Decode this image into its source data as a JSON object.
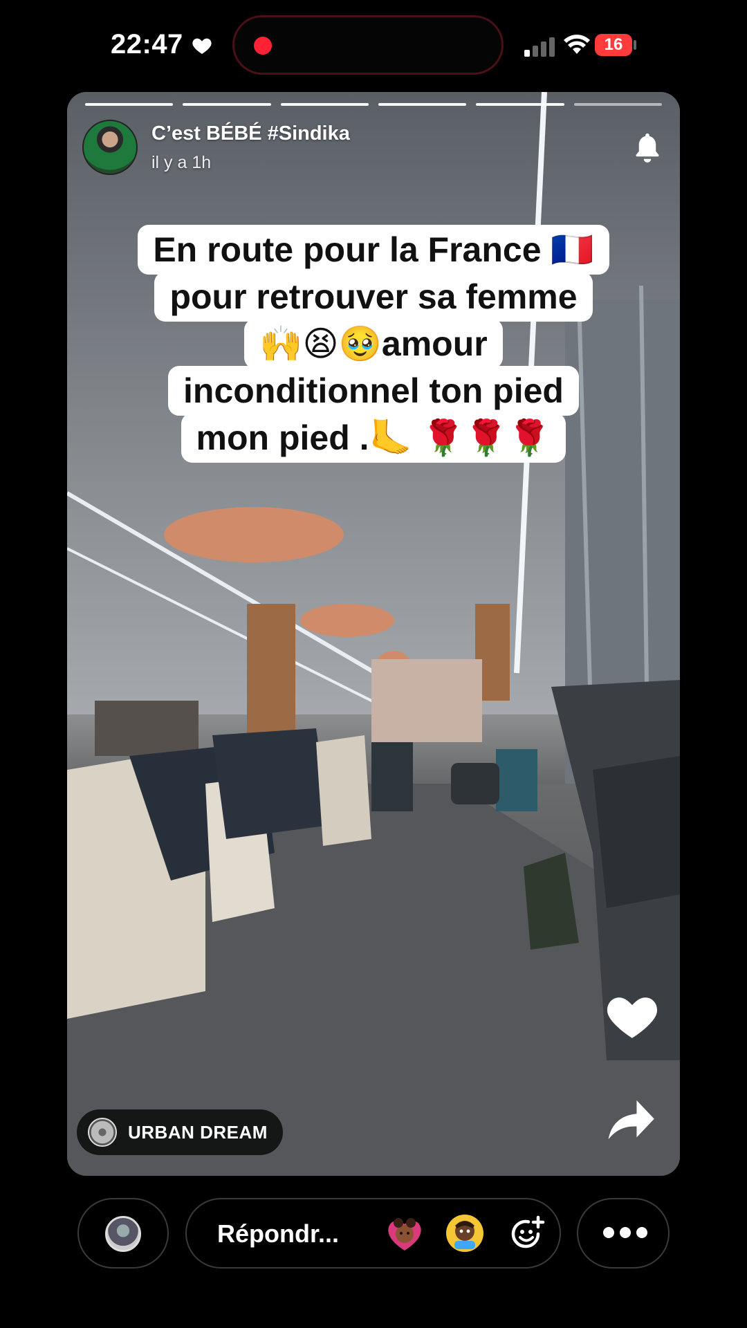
{
  "status_bar": {
    "time": "22:47",
    "battery_level": "16",
    "icons": [
      "heart-icon",
      "recording-dot-icon",
      "cellular-signal-icon",
      "wifi-icon",
      "battery-icon"
    ],
    "recording_color": "#ff2236",
    "battery_color": "#ff3b3b"
  },
  "story": {
    "progress_segments": 6,
    "progress_done": 5,
    "username": "C’est BÉBÉ #Sindika",
    "timestamp": "il y a 1h",
    "caption_lines": [
      "En route pour la France 🇫🇷",
      "pour retrouver sa femme",
      "🙌😫🥹amour",
      "inconditionnel ton pied",
      "mon pied .🦶 🌹🌹🌹"
    ],
    "music_label": "URBAN DREAM",
    "icons": [
      "bell-icon",
      "heart-icon",
      "share-icon",
      "music-disc-icon"
    ]
  },
  "bottom_bar": {
    "reply_placeholder": "Répondr...",
    "icons": [
      "avatar",
      "sticker-icon",
      "sticker-icon",
      "emoji-add-icon",
      "more-icon"
    ]
  }
}
